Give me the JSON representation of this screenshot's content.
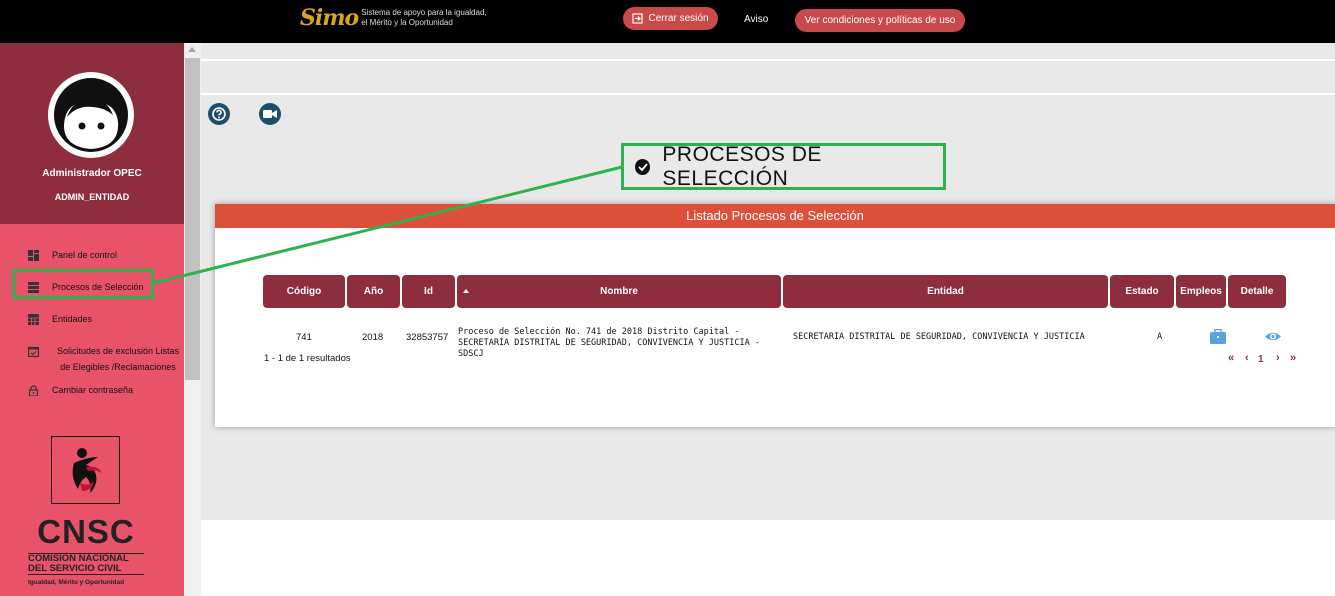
{
  "topbar": {
    "logo_mark": "Simo",
    "logo_line1": "Sistema de apoyo para la igualdad,",
    "logo_line2": "el Mérito y la Oportunidad",
    "logout_label": "Cerrar sesión",
    "aviso_label": "Aviso",
    "conditions_label": "Ver condiciones y políticas de uso"
  },
  "sidebar": {
    "user_name": "Administrador OPEC",
    "user_role": "ADMIN_ENTIDAD",
    "items": [
      {
        "label": "Panel de control",
        "icon": "dashboard-icon"
      },
      {
        "label": "Procesos de Selección",
        "icon": "list-icon"
      },
      {
        "label": "Entidades",
        "icon": "table-icon"
      },
      {
        "label": "Solicitudes de exclusión Listas de Elegibles /Reclamaciones",
        "icon": "calendar-check-icon"
      },
      {
        "label": "Cambiar contraseña",
        "icon": "lock-icon"
      }
    ],
    "org_logo": {
      "title": "CNSC",
      "line1": "COMISIÓN NACIONAL",
      "line2": "DEL SERVICIO CIVIL",
      "tagline": "Igualdad, Mérito y Oportunidad"
    }
  },
  "page": {
    "title": "PROCESOS DE SELECCIÓN",
    "card_title": "Listado Procesos de Selección"
  },
  "table": {
    "columns": [
      "Código",
      "Año",
      "Id",
      "Nombre",
      "Entidad",
      "Estado",
      "Empleos",
      "Detalle"
    ],
    "rows": [
      {
        "codigo": "741",
        "anio": "2018",
        "id": "32853757",
        "nombre": "Proceso de Selección No. 741 de 2018 Distrito Capital - SECRETARÍA DISTRITAL DE SEGURIDAD, CONVIVENCIA Y JUSTICIA - SDSCJ",
        "entidad": "SECRETARIA DISTRITAL DE SEGURIDAD, CONVIVENCIA Y JUSTICIA",
        "estado": "A"
      }
    ],
    "results_text": "1 - 1 de 1 resultados",
    "pager": {
      "first": "«",
      "prev": "‹",
      "page": "1",
      "next": "›",
      "last": "»"
    }
  },
  "colors": {
    "topbar": "#000000",
    "sidebar": "#e9536a",
    "profile": "#8d2d3e",
    "table_header": "#8d2d3e",
    "card_header": "#dc4f3a",
    "annotation": "#2fb14d"
  }
}
